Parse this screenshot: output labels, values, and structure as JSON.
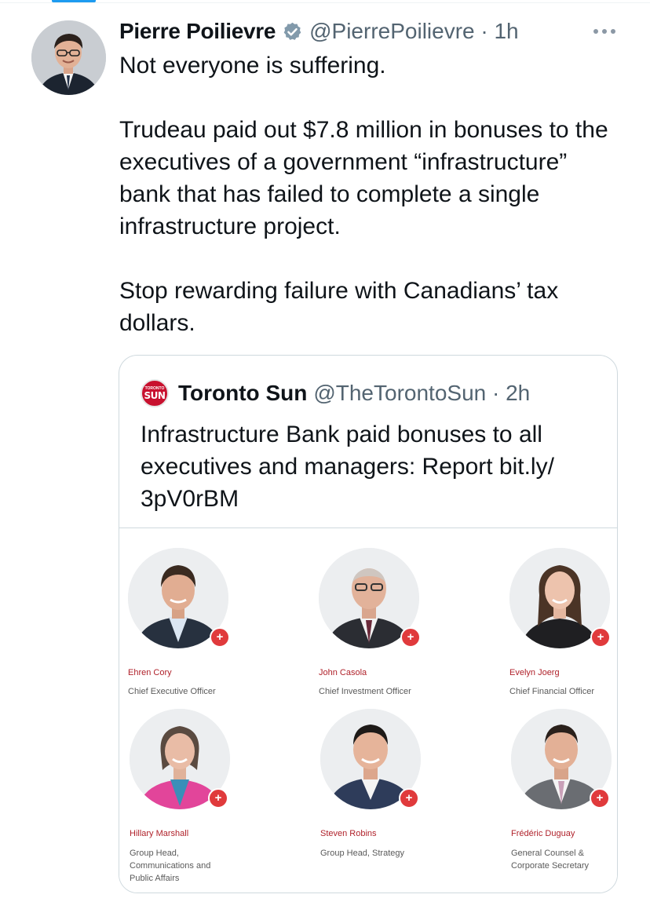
{
  "tweet": {
    "author_name": "Pierre Poilievre",
    "handle_time": "@PierrePoilievre · 1h",
    "more_icon": "more-dots-icon",
    "text": "Not everyone is suffering.\n\nTrudeau paid out $7.8 million in bonuses to the executives of a government “infrastructure” bank that has failed to complete a single infrastructure project.\n\nStop rewarding failure with Canadians’ tax dollars."
  },
  "quote": {
    "logo_small": "TORONTO",
    "logo_big": "SUN",
    "name": "Toronto Sun",
    "handle_time": "@TheTorontoSun · 2h",
    "text": "Infrastructure Bank paid bonuses to all executives and managers: Report bit.ly/\n3pV0rBM"
  },
  "executives": [
    {
      "name": "Ehren Cory",
      "title": "Chief Executive Officer"
    },
    {
      "name": "John Casola",
      "title": "Chief Investment Officer"
    },
    {
      "name": "Evelyn Joerg",
      "title": "Chief Financial Officer"
    },
    {
      "name": "Hillary Marshall",
      "title": "Group Head,\nCommunications and\nPublic Affairs"
    },
    {
      "name": "Steven Robins",
      "title": "Group Head, Strategy"
    },
    {
      "name": "Frédéric Duguay",
      "title": "General Counsel &\nCorporate Secretary"
    }
  ],
  "plus_symbol": "+",
  "colors": {
    "verified": "#829aab",
    "link": "#1d9bf0",
    "accent_red": "#c8102e",
    "plus_red": "#e03a3c"
  }
}
